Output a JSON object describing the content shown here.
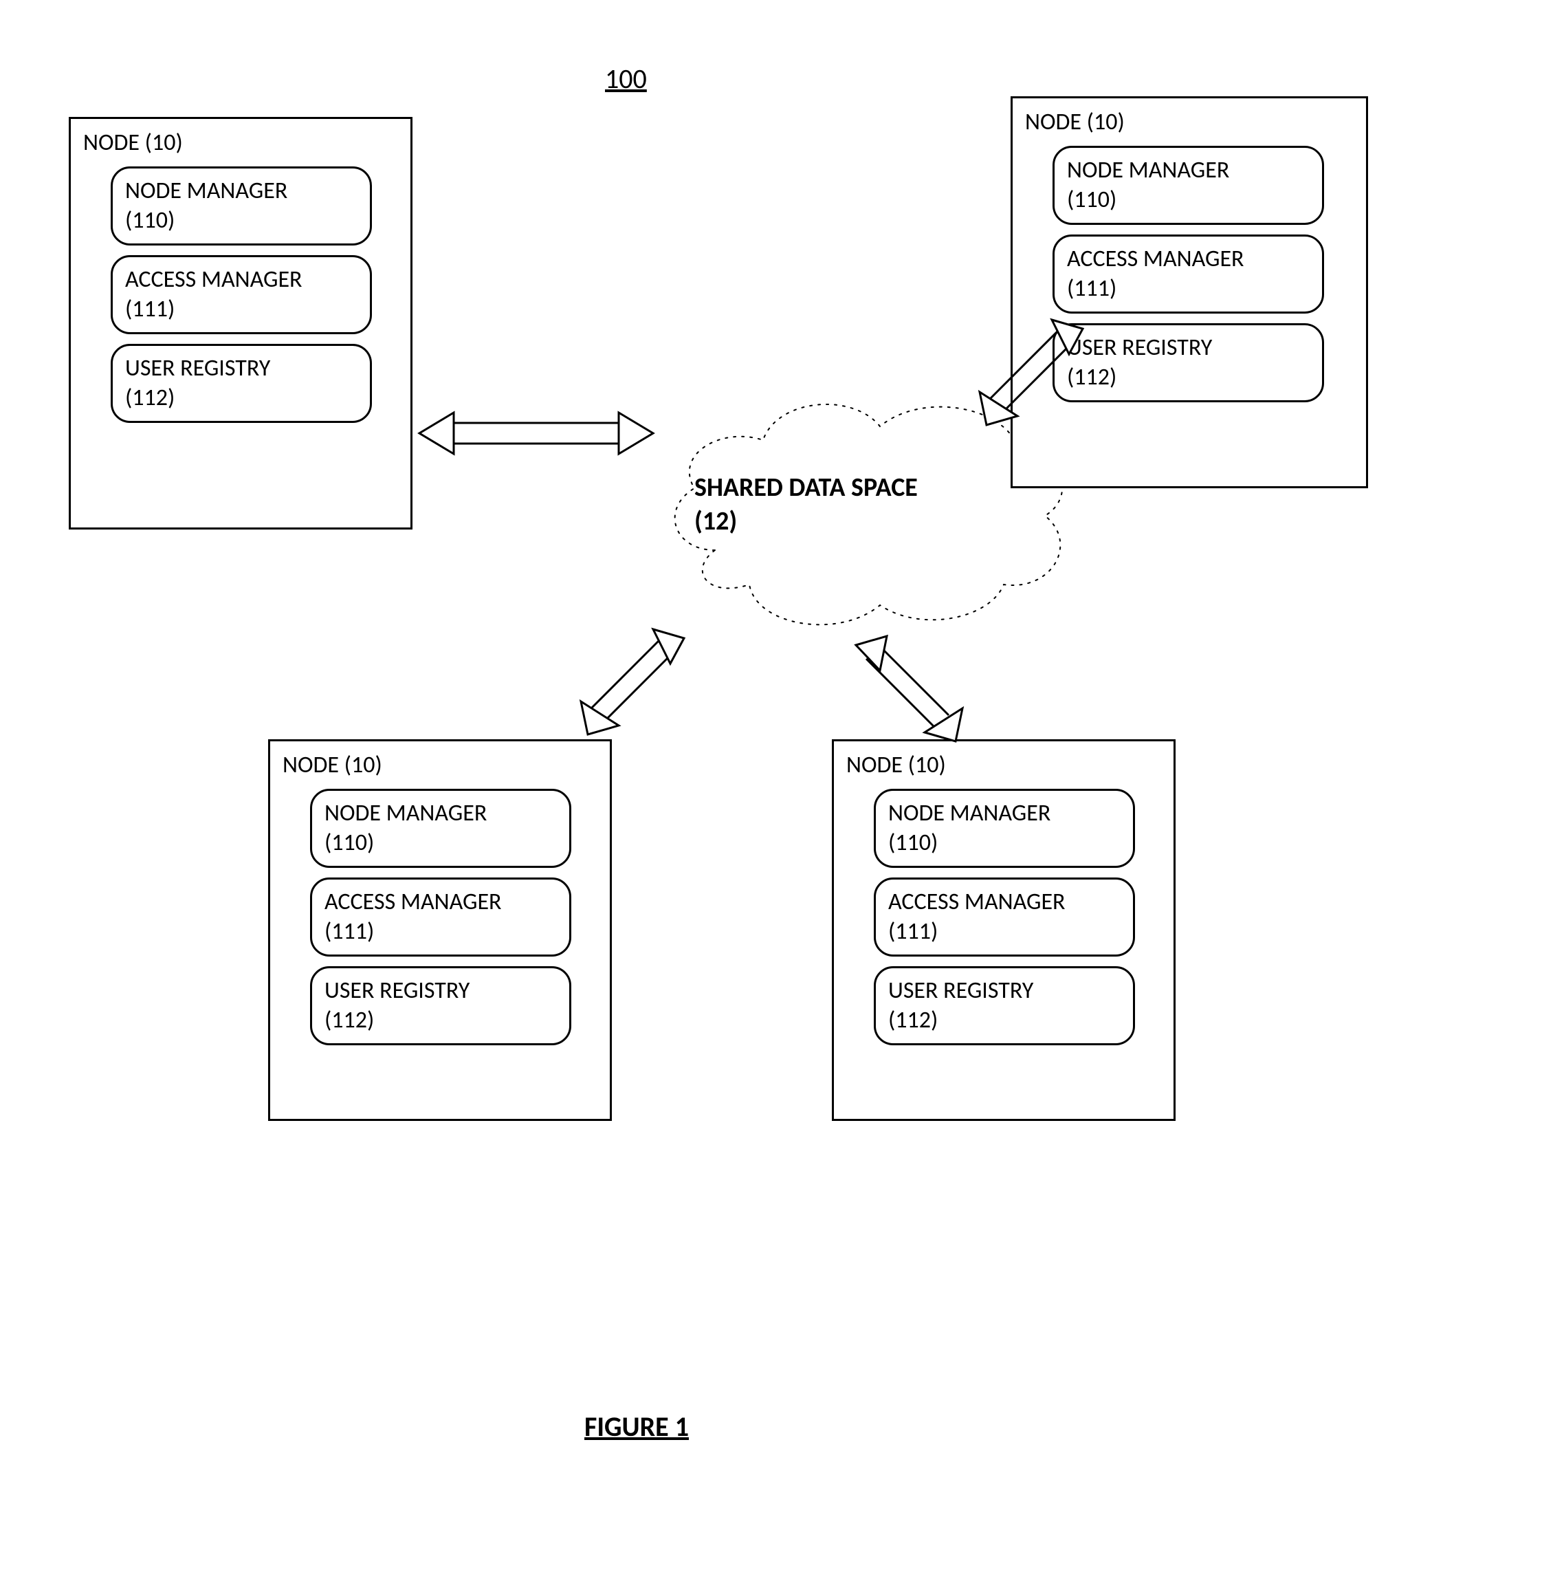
{
  "diagram": {
    "ref_number": "100",
    "figure_caption": "FIGURE 1",
    "cloud": {
      "label_l1": "SHARED DATA SPACE",
      "label_l2": "(12)"
    },
    "node_title": "NODE (10)",
    "components": {
      "node_manager_l1": "NODE MANAGER",
      "node_manager_l2": "(110)",
      "access_manager_l1": "ACCESS MANAGER",
      "access_manager_l2": "(111)",
      "user_registry_l1": "USER REGISTRY",
      "user_registry_l2": "(112)"
    }
  }
}
